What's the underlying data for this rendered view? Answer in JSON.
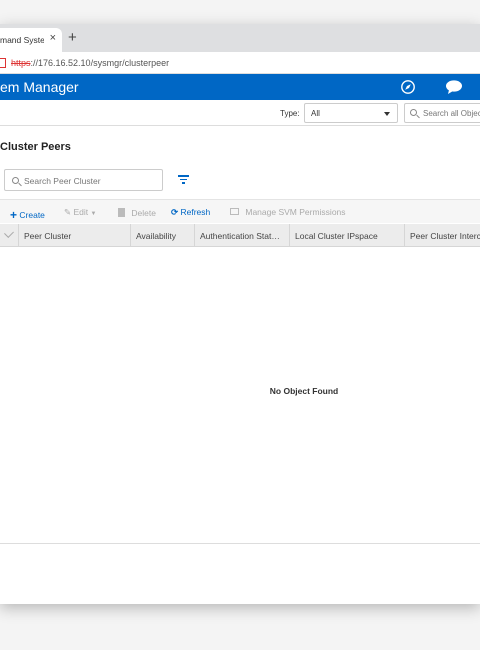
{
  "browser": {
    "tab_title": "mand Syste",
    "tab_close": "×",
    "new_tab": "+",
    "url_scheme": "https",
    "url_rest": "://176.16.52.10/sysmgr/clusterpeer"
  },
  "app": {
    "title": "em Manager",
    "header_color": "#0067c5"
  },
  "filters": {
    "type_label": "Type:",
    "type_value": "All",
    "search_placeholder": "Search all Objects"
  },
  "page": {
    "title": "Cluster Peers",
    "search_placeholder": "Search Peer Cluster"
  },
  "toolbar": {
    "create": "Create",
    "edit": "Edit",
    "delete": "Delete",
    "refresh": "Refresh",
    "manage_svm": "Manage SVM Permissions"
  },
  "table": {
    "columns": [
      "Peer Cluster",
      "Availability",
      "Authentication Stat…",
      "Local Cluster IPspace",
      "Peer Cluster Interc"
    ],
    "empty_message": "No Object Found"
  }
}
